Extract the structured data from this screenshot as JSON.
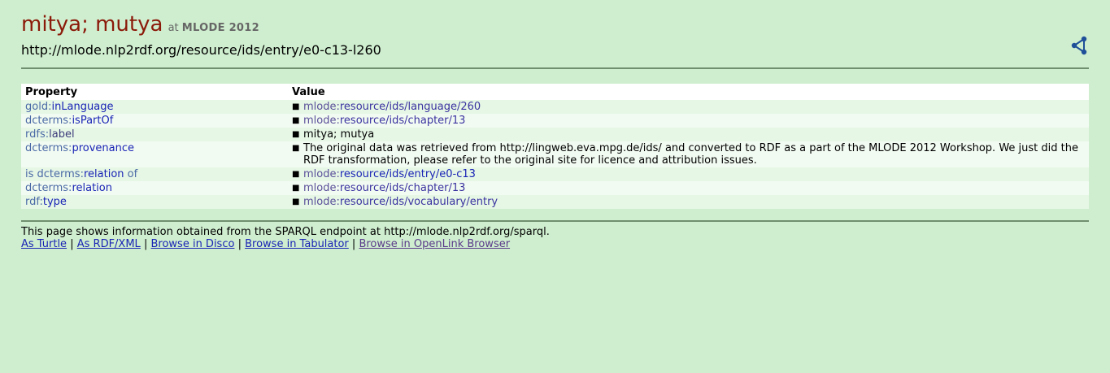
{
  "header": {
    "title": "mitya; mutya",
    "at": "at",
    "site": "MLODE 2012",
    "uri": "http://mlode.nlp2rdf.org/resource/ids/entry/e0-c13-l260",
    "share_icon": "share-icon"
  },
  "table": {
    "col_property": "Property",
    "col_value": "Value",
    "rows": [
      {
        "prop_ns": "gold:",
        "prop_local": "inLanguage",
        "value_ns": "mlode:",
        "value_local": "resource/ids/language/260"
      },
      {
        "prop_ns": "dcterms:",
        "prop_local": "isPartOf",
        "value_ns": "mlode:",
        "value_local": "resource/ids/chapter/13"
      },
      {
        "prop_ns": "rdfs:",
        "prop_local": "label",
        "value_text": "mitya; mutya"
      },
      {
        "prop_ns": "dcterms:",
        "prop_local": "provenance",
        "value_text": "The original data was retrieved from http://lingweb.eva.mpg.de/ids/ and converted to RDF as a part of the MLODE 2012 Workshop. We just did the RDF transformation, please refer to the original site for licence and attribution issues."
      },
      {
        "prop_prefix": "is",
        "prop_ns": "dcterms:",
        "prop_local": "relation",
        "prop_suffix": "of",
        "value_ns": "mlode:",
        "value_local": "resource/ids/entry/e0-c13"
      },
      {
        "prop_ns": "dcterms:",
        "prop_local": "relation",
        "value_ns": "mlode:",
        "value_local": "resource/ids/chapter/13"
      },
      {
        "prop_ns": "rdf:",
        "prop_local": "type",
        "value_ns": "mlode:",
        "value_local": "resource/ids/vocabulary/entry"
      }
    ]
  },
  "footer": {
    "info": "This page shows information obtained from the SPARQL endpoint at http://mlode.nlp2rdf.org/sparql.",
    "links": [
      "As Turtle",
      "As RDF/XML",
      "Browse in Disco",
      "Browse in Tabulator",
      "Browse in OpenLink Browser"
    ],
    "separator": "|"
  }
}
